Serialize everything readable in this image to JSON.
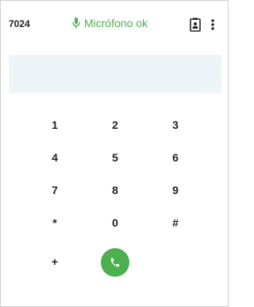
{
  "header": {
    "extension": "7024",
    "mic_status": "Micrófono ok",
    "mic_color": "#4caf50",
    "icons": {
      "mic": "microphone-icon",
      "contacts": "contact-card-icon",
      "menu": "more-vertical-icon"
    }
  },
  "display": {
    "value": "",
    "background": "#eef5f8"
  },
  "keypad": {
    "keys": [
      "1",
      "2",
      "3",
      "4",
      "5",
      "6",
      "7",
      "8",
      "9",
      "*",
      "0",
      "#"
    ],
    "plus_label": "+"
  },
  "call": {
    "icon": "phone-icon",
    "color": "#4caf50"
  }
}
